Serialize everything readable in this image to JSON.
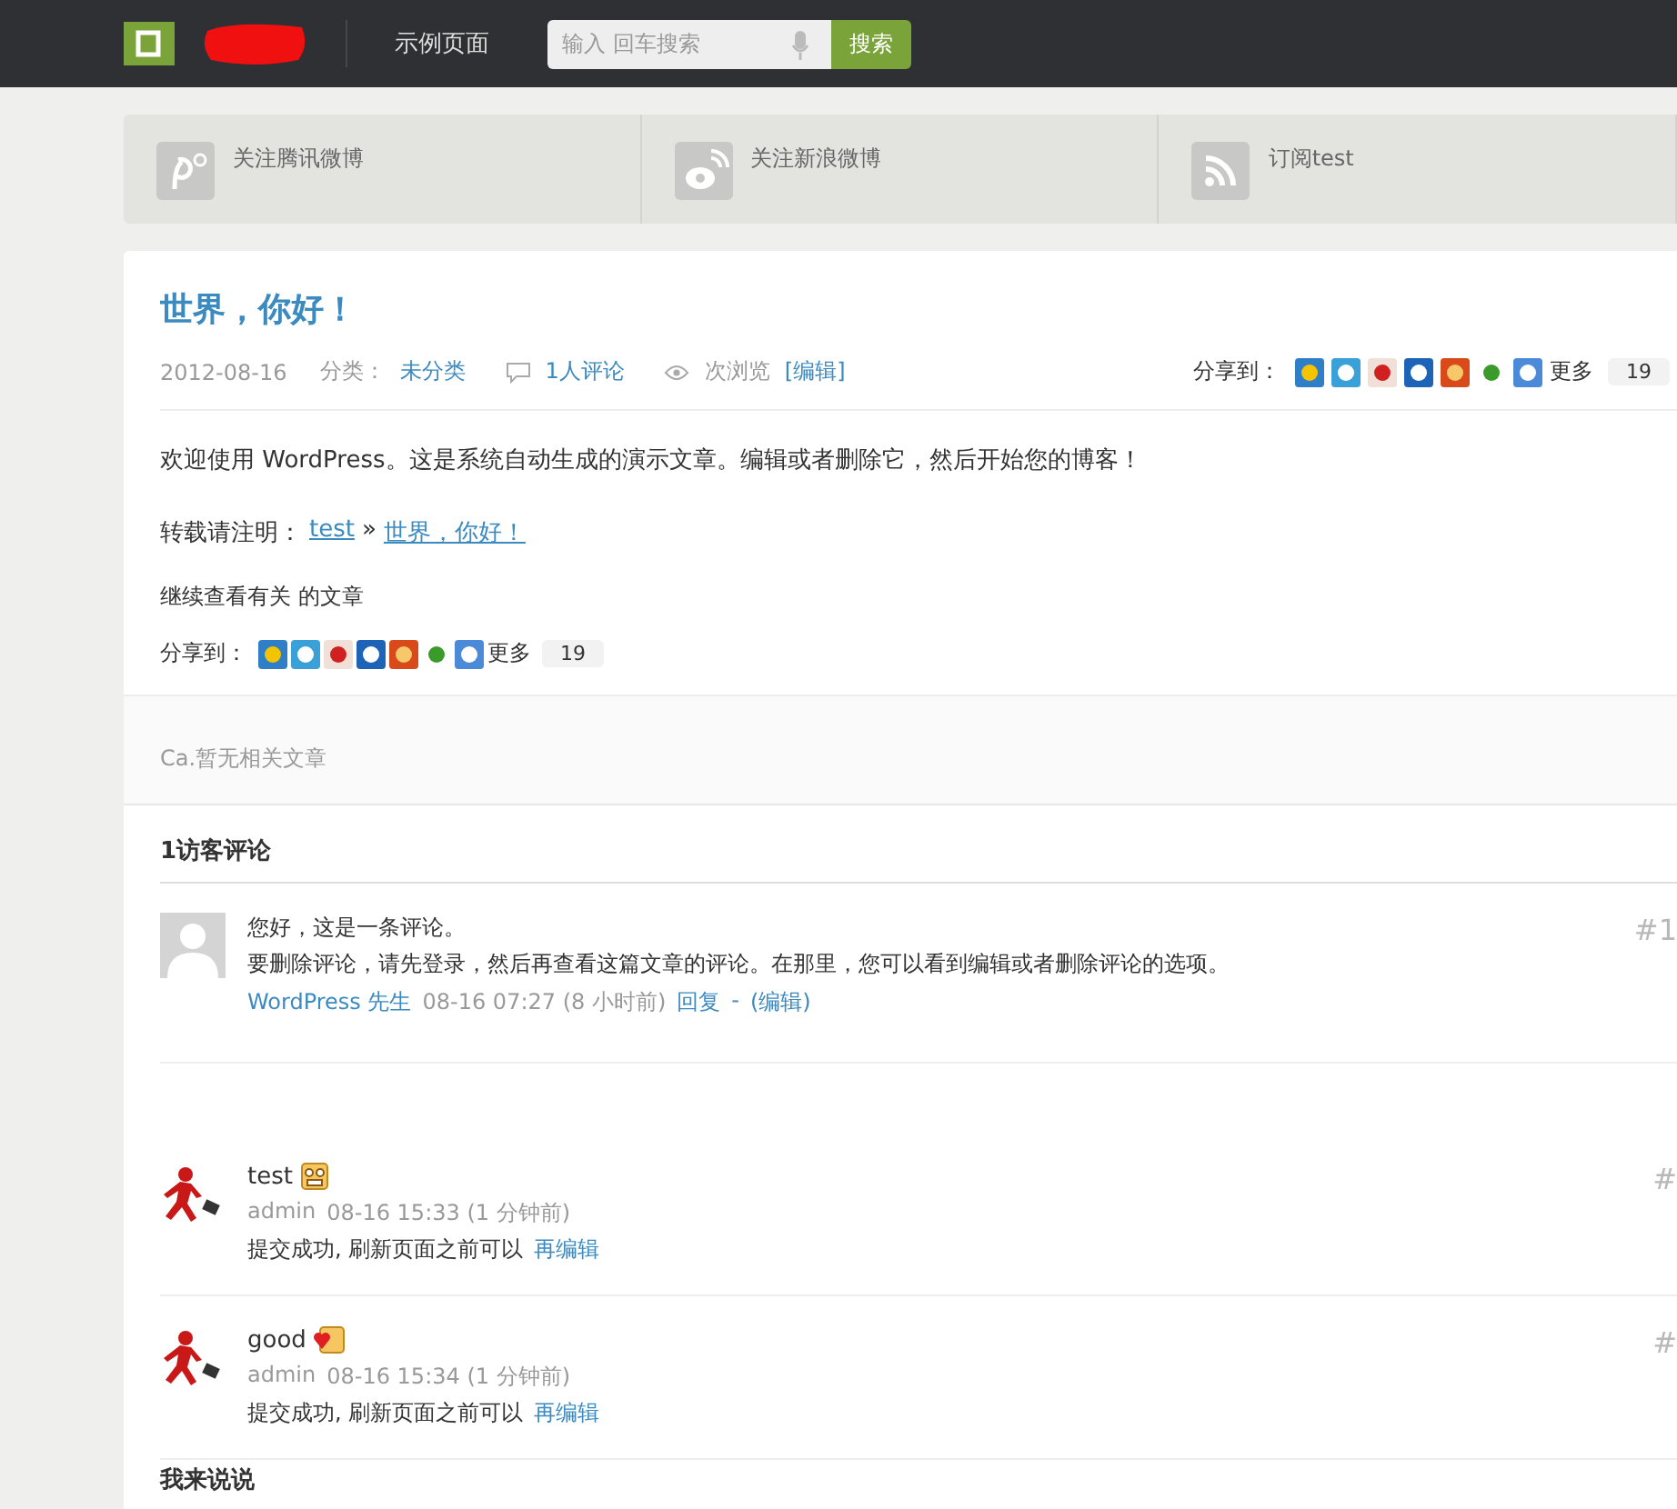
{
  "header": {
    "nav": [
      "示例页面"
    ],
    "search": {
      "placeholder": "输入 回车搜索",
      "button": "搜索"
    }
  },
  "follow_bar": [
    {
      "kind": "tencent",
      "label": "关注腾讯微博"
    },
    {
      "kind": "sina",
      "label": "关注新浪微博"
    },
    {
      "kind": "rss",
      "label": "订阅test"
    }
  ],
  "post": {
    "title": "世界，你好！",
    "date": "2012-08-16",
    "category_label": "分类：",
    "category": "未分类",
    "comments": "1人评论",
    "views": "次浏览",
    "edit": "[编辑]",
    "share_top": {
      "label": "分享到：",
      "more": "更多",
      "count": "19"
    },
    "body": "欢迎使用 WordPress。这是系统自动生成的演示文章。编辑或者删除它，然后开始您的博客！",
    "reprint": {
      "prefix": "转载请注明：",
      "site": "test",
      "sep": "»",
      "post": "世界，你好！"
    },
    "related_hint": "继续查看有关 的文章",
    "share_bottom": {
      "label": "分享到：",
      "more": "更多",
      "count": "19"
    }
  },
  "related": "Ca.暂无相关文章",
  "comments_heading": "1访客评论",
  "comments": [
    {
      "kind": "guest",
      "lines": [
        "您好，这是一条评论。",
        "要删除评论，请先登录，然后再查看这篇文章的评论。在那里，您可以看到编辑或者删除评论的选项。"
      ],
      "author": "WordPress 先生",
      "time": "08-16 07:27 (8 小时前)",
      "reply": "回复",
      "sep": "-",
      "edit": "(编辑)",
      "floor": "#1"
    },
    {
      "kind": "admin",
      "text": "test",
      "emoji": {
        "kind": "grin"
      },
      "author": "admin",
      "time": "08-16 15:33 (1 分钟前)",
      "note": "提交成功, 刷新页面之前可以",
      "note_link": "再编辑",
      "floor": "#"
    },
    {
      "kind": "admin",
      "text": "good",
      "emoji": {
        "kind": "love"
      },
      "author": "admin",
      "time": "08-16 15:34 (1 分钟前)",
      "note": "提交成功, 刷新页面之前可以",
      "note_link": "再编辑",
      "floor": "#"
    }
  ],
  "reply_heading": "我来说说"
}
